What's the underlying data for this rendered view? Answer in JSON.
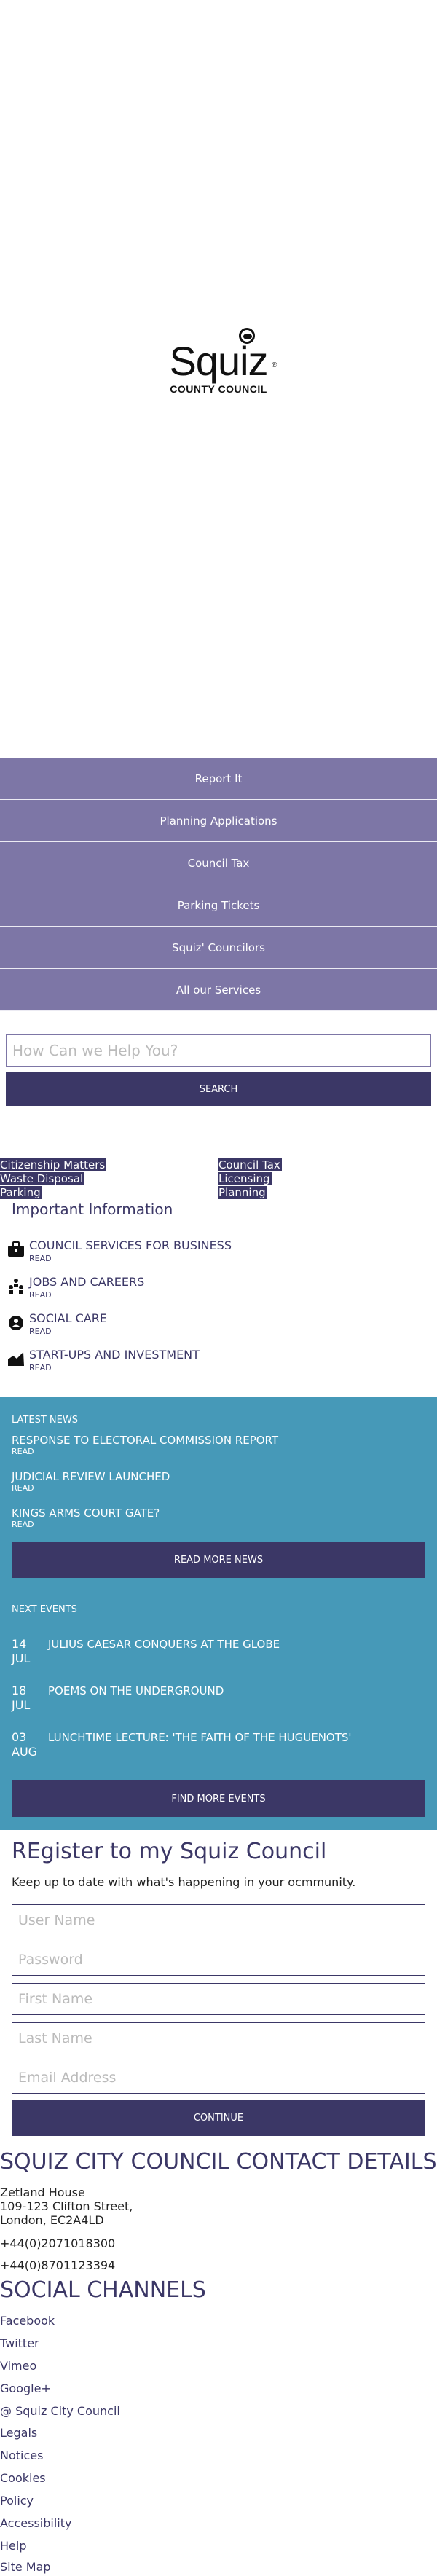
{
  "logo": {
    "name": "Squiz",
    "registered": "®",
    "subtitle": "COUNTY COUNCIL"
  },
  "nav": {
    "items": [
      "Report It",
      "Planning Applications",
      "Council Tax",
      "Parking Tickets",
      "Squiz' Councilors",
      "All our Services"
    ]
  },
  "search": {
    "placeholder": "How Can we Help You?",
    "button": "SEARCH"
  },
  "quick_links": {
    "left": [
      "Citizenship Matters",
      "Waste Disposal",
      "Parking"
    ],
    "right": [
      "Council Tax",
      "Licensing",
      "Planning"
    ]
  },
  "important": {
    "title": "Important Information",
    "items": [
      {
        "name": "COUNCIL SERVICES FOR BUSINESS",
        "read": "READ",
        "icon": "briefcase-icon"
      },
      {
        "name": "JOBS AND CAREERS",
        "read": "READ",
        "icon": "people-icon"
      },
      {
        "name": "SOCIAL CARE",
        "read": "READ",
        "icon": "person-icon"
      },
      {
        "name": "START-UPS AND INVESTMENT",
        "read": "READ",
        "icon": "growth-icon"
      }
    ]
  },
  "news": {
    "label": "LATEST NEWS",
    "items": [
      {
        "title": "RESPONSE TO ELECTORAL COMMISSION REPORT",
        "read": "READ"
      },
      {
        "title": "JUDICIAL REVIEW LAUNCHED",
        "read": "READ"
      },
      {
        "title": "KINGS ARMS COURT GATE?",
        "read": "READ"
      }
    ],
    "button": "READ MORE NEWS"
  },
  "events": {
    "label": "NEXT EVENTS",
    "items": [
      {
        "day": "14",
        "month": "JUL",
        "title": "JULIUS CAESAR CONQUERS AT THE GLOBE"
      },
      {
        "day": "18",
        "month": "JUL",
        "title": "POEMS ON THE UNDERGROUND"
      },
      {
        "day": "03",
        "month": "AUG",
        "title": "LUNCHTIME LECTURE: 'THE FAITH OF THE HUGUENOTS'"
      }
    ],
    "button": "FIND MORE EVENTS"
  },
  "register": {
    "title": "REgister to my Squiz Council",
    "subtitle": "Keep up to date with what's happening in your ocmmunity.",
    "fields": [
      "User Name",
      "Password",
      "First Name",
      "Last Name",
      "Email Address"
    ],
    "button": "CONTINUE"
  },
  "contact": {
    "title": "SQUIZ CITY COUNCIL CONTACT DETAILS",
    "address": [
      "Zetland House",
      "109-123 Clifton Street,",
      "London, EC2A4LD"
    ],
    "phones": [
      "+44(0)2071018300",
      "+44(0)8701123394"
    ]
  },
  "social": {
    "title": "SOCIAL CHANNELS",
    "links": [
      "Facebook",
      "Twitter",
      "Vimeo",
      "Google+",
      "@ Squiz City Council"
    ]
  },
  "footer": {
    "links": [
      "Legals",
      "Notices",
      "Cookies",
      "Policy",
      "Accessibility",
      "Help",
      "Site Map"
    ]
  }
}
